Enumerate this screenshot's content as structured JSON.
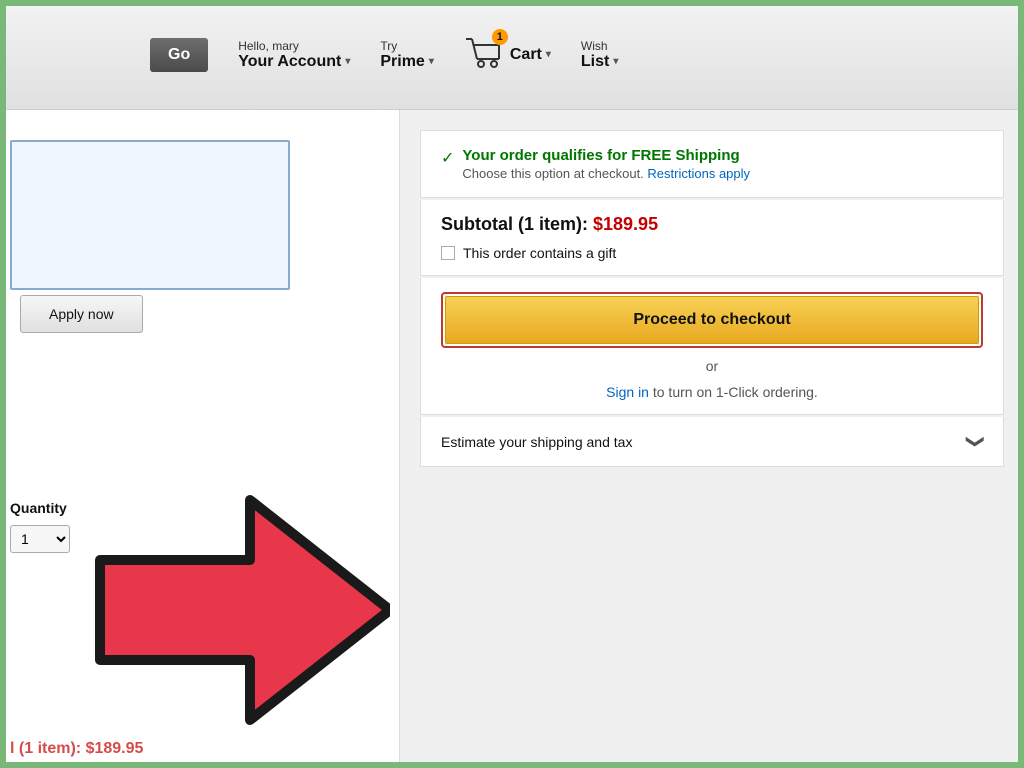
{
  "header": {
    "go_button": "Go",
    "greeting": "Hello, mary",
    "your_account_label": "Your Account",
    "your_account_arrow": "▾",
    "try_label": "Try",
    "prime_label": "Prime",
    "prime_arrow": "▾",
    "cart_count": "1",
    "cart_label": "Cart",
    "cart_arrow": "▾",
    "wish_label": "Wish",
    "list_label": "List",
    "list_arrow": "▾"
  },
  "left_panel": {
    "apply_now_label": "Apply now",
    "quantity_label": "Quantity",
    "quantity_value": "1",
    "bottom_partial": "l (1 item): $189.95"
  },
  "right_panel": {
    "free_shipping_headline": "Your order qualifies for FREE Shipping",
    "free_shipping_sub": "Choose this option at checkout.",
    "restrictions_link": "Restrictions apply",
    "subtotal_label": "Subtotal (1 item):",
    "subtotal_price": "$189.95",
    "gift_label": "This order contains a gift",
    "checkout_btn_label": "Proceed to checkout",
    "or_text": "or",
    "sign_in_link": "Sign in",
    "sign_in_suffix": " to turn on 1-Click ordering.",
    "estimate_shipping_label": "Estimate your shipping and tax",
    "chevron": "❯"
  }
}
